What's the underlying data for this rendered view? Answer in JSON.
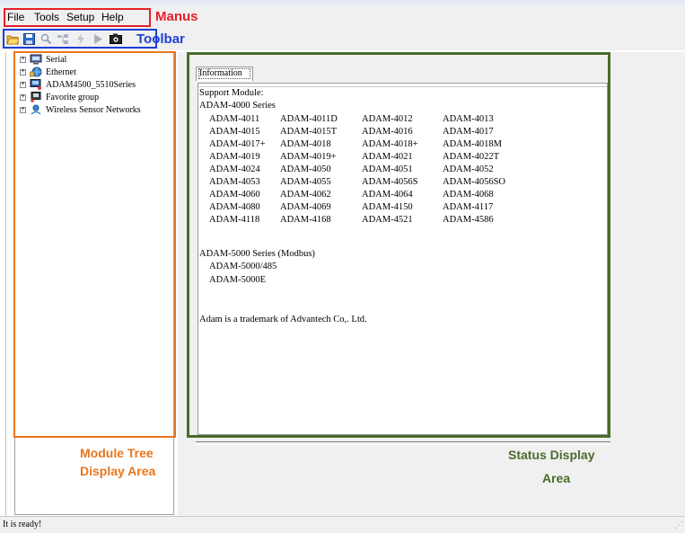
{
  "menu": {
    "items": [
      "File",
      "Tools",
      "Setup",
      "Help"
    ]
  },
  "toolbar": {
    "icons": [
      "open-icon",
      "save-icon",
      "search-icon",
      "scan-icon",
      "terminal-icon",
      "run-icon",
      "camera-icon"
    ]
  },
  "tree": {
    "items": [
      {
        "label": "Serial",
        "icon": "serial-port-icon"
      },
      {
        "label": "Ethernet",
        "icon": "ethernet-icon"
      },
      {
        "label": "ADAM4500_5510Series",
        "icon": "adam-device-icon"
      },
      {
        "label": "Favorite group",
        "icon": "favorite-group-icon"
      },
      {
        "label": "Wireless Sensor Networks",
        "icon": "wireless-icon"
      }
    ]
  },
  "info": {
    "tab_label": "Information",
    "support_heading": "Support Module:",
    "series_4000_title": "ADAM-4000 Series",
    "series_4000_rows": [
      [
        "ADAM-4011",
        "ADAM-4011D",
        "ADAM-4012",
        "ADAM-4013"
      ],
      [
        "ADAM-4015",
        "ADAM-4015T",
        "ADAM-4016",
        "ADAM-4017"
      ],
      [
        "ADAM-4017+",
        "ADAM-4018",
        "ADAM-4018+",
        "ADAM-4018M"
      ],
      [
        "ADAM-4019",
        "ADAM-4019+",
        "ADAM-4021",
        "ADAM-4022T"
      ],
      [
        "ADAM-4024",
        "ADAM-4050",
        "ADAM-4051",
        "ADAM-4052"
      ],
      [
        "ADAM-4053",
        "ADAM-4055",
        "ADAM-4056S",
        "ADAM-4056SO"
      ],
      [
        "ADAM-4060",
        "ADAM-4062",
        "ADAM-4064",
        "ADAM-4068"
      ],
      [
        "ADAM-4080",
        "ADAM-4069",
        "ADAM-4150",
        "ADAM-4117"
      ],
      [
        "ADAM-4118",
        "ADAM-4168",
        "ADAM-4521",
        "ADAM-4586"
      ]
    ],
    "series_5000_title": "ADAM-5000 Series (Modbus)",
    "series_5000_items": [
      "ADAM-5000/485",
      "ADAM-5000E"
    ],
    "trademark": "Adam is a trademark of Advantech Co,. Ltd."
  },
  "status": {
    "text": "It is ready!"
  },
  "annotations": {
    "menus": "Manus",
    "toolbar": "Toolbar",
    "tree_line1": "Module Tree",
    "tree_line2": "Display Area",
    "status_line1": "Status Display",
    "status_line2": "Area"
  },
  "colors": {
    "menus_annot": "#e8202a",
    "toolbar_annot": "#1f3ed6",
    "tree_annot": "#e8761e",
    "status_annot": "#4a6b2a"
  }
}
